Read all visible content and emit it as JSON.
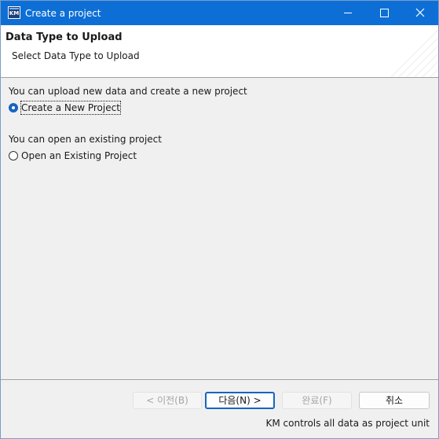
{
  "window": {
    "title": "Create a project",
    "app_icon_text": "KM",
    "accent": "#0d6fd6"
  },
  "banner": {
    "title": "Data Type to Upload",
    "subtitle": "Select Data Type to Upload"
  },
  "options": {
    "new_description": "You can upload new data and create a new project",
    "new_label": "Create a New Project",
    "new_selected": true,
    "existing_description": "You can open an existing project",
    "existing_label": "Open an Existing Project",
    "existing_selected": false
  },
  "buttons": {
    "prev": "< 이전(B)",
    "next": "다음(N) >",
    "finish": "완료(F)",
    "cancel": "취소"
  },
  "status": "KM controls all data as project unit",
  "icons": {
    "minimize": "minimize-icon",
    "maximize": "maximize-icon",
    "close": "close-icon"
  }
}
